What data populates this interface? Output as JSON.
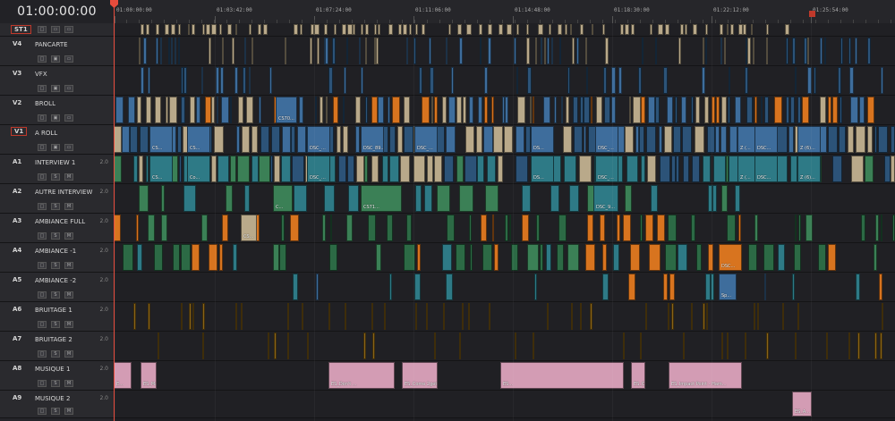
{
  "timecode": "01:00:00:00",
  "ruler_ticks": [
    "01:00:00:00",
    "01:03:42:00",
    "01:07:24:00",
    "01:11:06:00",
    "01:14:48:00",
    "01:18:30:00",
    "01:22:12:00",
    "01:25:54:00"
  ],
  "colors": {
    "blue": "#3e6d9c",
    "blue_dark": "#2c5378",
    "tan": "#b9a98a",
    "orange": "#d8741f",
    "teal": "#2e7a86",
    "green": "#3b8056",
    "green_dark": "#2c6a45",
    "brown": "#8a6418",
    "pink": "#d39cb4",
    "playhead": "#e74c3c"
  },
  "tracks": [
    {
      "id": "ST1",
      "name": "",
      "channels": "",
      "boxed": true,
      "height": 15,
      "buttons": [
        "lock-icon",
        "monitor-icon",
        "subtitle-icon"
      ]
    },
    {
      "id": "V4",
      "name": "PANCARTE",
      "channels": "",
      "boxed": false,
      "height": 33,
      "buttons": [
        "lock-icon",
        "film-icon",
        "monitor-icon"
      ]
    },
    {
      "id": "V3",
      "name": "VFX",
      "channels": "",
      "boxed": false,
      "height": 33,
      "buttons": [
        "lock-icon",
        "film-icon",
        "monitor-icon"
      ]
    },
    {
      "id": "V2",
      "name": "BROLL",
      "channels": "",
      "boxed": false,
      "height": 33,
      "buttons": [
        "lock-icon",
        "film-icon",
        "monitor-icon"
      ]
    },
    {
      "id": "V1",
      "name": "A ROLL",
      "channels": "",
      "boxed": true,
      "height": 33,
      "buttons": [
        "lock-icon",
        "film-icon",
        "monitor-icon"
      ]
    },
    {
      "id": "A1",
      "name": "INTERVIEW 1",
      "channels": "2.0",
      "boxed": false,
      "height": 33,
      "buttons": [
        "lock-icon",
        "S",
        "M"
      ]
    },
    {
      "id": "A2",
      "name": "AUTRE INTERVIEW",
      "channels": "2.0",
      "boxed": false,
      "height": 33,
      "buttons": [
        "lock-icon",
        "S",
        "M"
      ]
    },
    {
      "id": "A3",
      "name": "AMBIANCE FULL",
      "channels": "2.0",
      "boxed": false,
      "height": 33,
      "buttons": [
        "lock-icon",
        "S",
        "M"
      ]
    },
    {
      "id": "A4",
      "name": "AMBIANCE -1",
      "channels": "2.0",
      "boxed": false,
      "height": 33,
      "buttons": [
        "lock-icon",
        "S",
        "M"
      ]
    },
    {
      "id": "A5",
      "name": "AMBIANCE -2",
      "channels": "2.0",
      "boxed": false,
      "height": 33,
      "buttons": [
        "lock-icon",
        "S",
        "M"
      ]
    },
    {
      "id": "A6",
      "name": "BRUITAGE 1",
      "channels": "2.0",
      "boxed": false,
      "height": 33,
      "buttons": [
        "lock-icon",
        "S",
        "M"
      ]
    },
    {
      "id": "A7",
      "name": "BRUITAGE 2",
      "channels": "2.0",
      "boxed": false,
      "height": 33,
      "buttons": [
        "lock-icon",
        "S",
        "M"
      ]
    },
    {
      "id": "A8",
      "name": "MUSIQUE 1",
      "channels": "2.0",
      "boxed": false,
      "height": 33,
      "buttons": [
        "lock-icon",
        "S",
        "M"
      ]
    },
    {
      "id": "A9",
      "name": "MUSIQUE 2",
      "channels": "2.0",
      "boxed": false,
      "height": 31,
      "buttons": [
        "lock-icon",
        "S",
        "M"
      ]
    }
  ],
  "clip_labels": {
    "v2": [
      "CS70..."
    ],
    "v1": [
      "CS...",
      "CS...",
      "DSC_...",
      "DSC_89...",
      "DSC_...",
      "DS...",
      "DSC_...",
      "Z (...",
      "DSC...",
      "Z (6)..."
    ],
    "a1": [
      "CS...",
      "Co...",
      "DSC_...",
      "DS...",
      "DSC_...",
      "Z (...",
      "DSC...",
      "Z (6)..."
    ],
    "a2": [
      "C...",
      "CS71...",
      "DSC_9..."
    ],
    "a3": [
      "CS..."
    ],
    "a4": [
      "DSC..."
    ],
    "a5": [
      "Sp..."
    ],
    "a8": [
      "E...",
      "ES_Make Up for No...",
      "ES_Don't ...",
      "ES_Come 2gether - Ooyy.mp3",
      "ES...",
      "ES_Overcoming - Cos...",
      "ES_Impact Point - Ham..."
    ],
    "a9": [
      "ES_A..."
    ]
  }
}
